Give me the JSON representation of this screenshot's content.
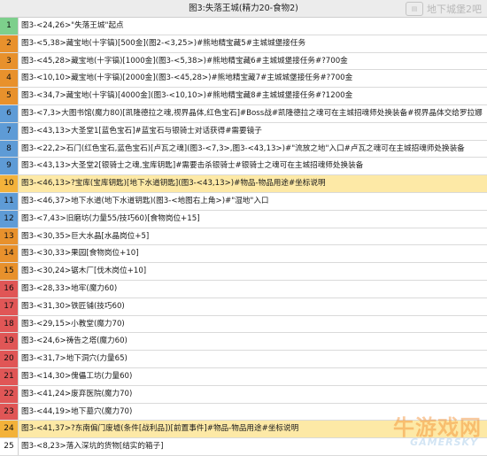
{
  "title": "图3:失落王城(精力20-食物2)",
  "top_watermark": "地下城堡2吧",
  "top_watermark_logo": "tieba",
  "bottom_watermark": {
    "cn": "牛游戏网",
    "en": "GAMERSKY"
  },
  "colors": {
    "rank_1": "#7dcf8c",
    "rank_2_5": "#e8912c",
    "rank_6_9": "#5e9bd6",
    "rank_10": "#f3b23a",
    "rank_11_12": "#5e9bd6",
    "rank_13_15": "#e8912c",
    "rank_16_23": "#e05656",
    "rank_24": "#f3b23a",
    "highlight_bg": "#fde9a6"
  },
  "rows": [
    {
      "n": "1",
      "text": "图3-<24,26>\"失落王城\"起点"
    },
    {
      "n": "2",
      "text": "图3-<5,38>藏宝地(十字镐)[500金](图2-<3,25>)#熊地精宝藏5#主城城堡接任务"
    },
    {
      "n": "3",
      "text": "图3-<45,28>藏宝地(十字镐)[1000金](图3-<5,38>)#熊地精宝藏6#主城城堡接任务#?700金"
    },
    {
      "n": "4",
      "text": "图3-<10,10>藏宝地(十字镐)[2000金](图3-<45,28>)#熊地精宝藏7#主城城堡接任务#?700金"
    },
    {
      "n": "5",
      "text": "图3-<34,7>藏宝地(十字镐)[4000金](图3-<10,10>)#熊地精宝藏8#主城城堡接任务#?1200金"
    },
    {
      "n": "6",
      "text": "图3-<7,3>大图书馆(魔力80)[凯隆德拉之魂,视界晶体,红色宝石]#Boss战#凯隆德拉之魂可在主城招魂师处换装备#视界晶体交给罗拉娜"
    },
    {
      "n": "7",
      "text": "图3-<43,13>大圣堂1[蓝色宝石]#蓝宝石与银骑士对话获得#需要镜子"
    },
    {
      "n": "8",
      "text": "图3-<22,2>石门(红色宝石,蓝色宝石)[卢瓦之魂](图3-<7,3>,图3-<43,13>)#\"流放之地\"入口#卢瓦之魂可在主城招魂师处换装备"
    },
    {
      "n": "9",
      "text": "图3-<43,13>大圣堂2[银骑士之魂,宝库钥匙]#需要击杀银骑士#银骑士之魂可在主城招魂师处换装备"
    },
    {
      "n": "10",
      "text": "图3-<46,13>?宝库(宝库钥匙)[地下水道钥匙](图3-<43,13>)#物品-物品用途#坐标说明",
      "hl": true
    },
    {
      "n": "11",
      "text": "图3-<46,37>地下水道(地下水道钥匙)(图3-<地图右上角>)#\"湿地\"入口"
    },
    {
      "n": "12",
      "text": "图3-<7,43>旧磨坊(力量55/技巧60)[食物岗位+15]"
    },
    {
      "n": "13",
      "text": "图3-<30,35>巨大水晶[水晶岗位+5]"
    },
    {
      "n": "14",
      "text": "图3-<30,33>果园[食物岗位+10]"
    },
    {
      "n": "15",
      "text": "图3-<30,24>锯木厂[伐木岗位+10]"
    },
    {
      "n": "16",
      "text": "图3-<28,33>地牢(魔力60)"
    },
    {
      "n": "17",
      "text": "图3-<31,30>铁匠铺(技巧60)"
    },
    {
      "n": "18",
      "text": "图3-<29,15>小教堂(魔力70)"
    },
    {
      "n": "19",
      "text": "图3-<24,6>祷告之塔(魔力60)"
    },
    {
      "n": "20",
      "text": "图3-<31,7>地下洞穴(力量65)"
    },
    {
      "n": "21",
      "text": "图3-<14,30>傀儡工坊(力量60)"
    },
    {
      "n": "22",
      "text": "图3-<41,24>废弃医院(魔力70)"
    },
    {
      "n": "23",
      "text": "图3-<44,19>地下墓穴(魔力70)"
    },
    {
      "n": "24",
      "text": "图3-<41,37>?东南偏门废墟(条件[战利品])[前置事件]#物品-物品用途#坐标说明",
      "hl": true
    },
    {
      "n": "25",
      "text": "图3-<8,23>落入深坑的货物[结实的箱子]"
    }
  ]
}
